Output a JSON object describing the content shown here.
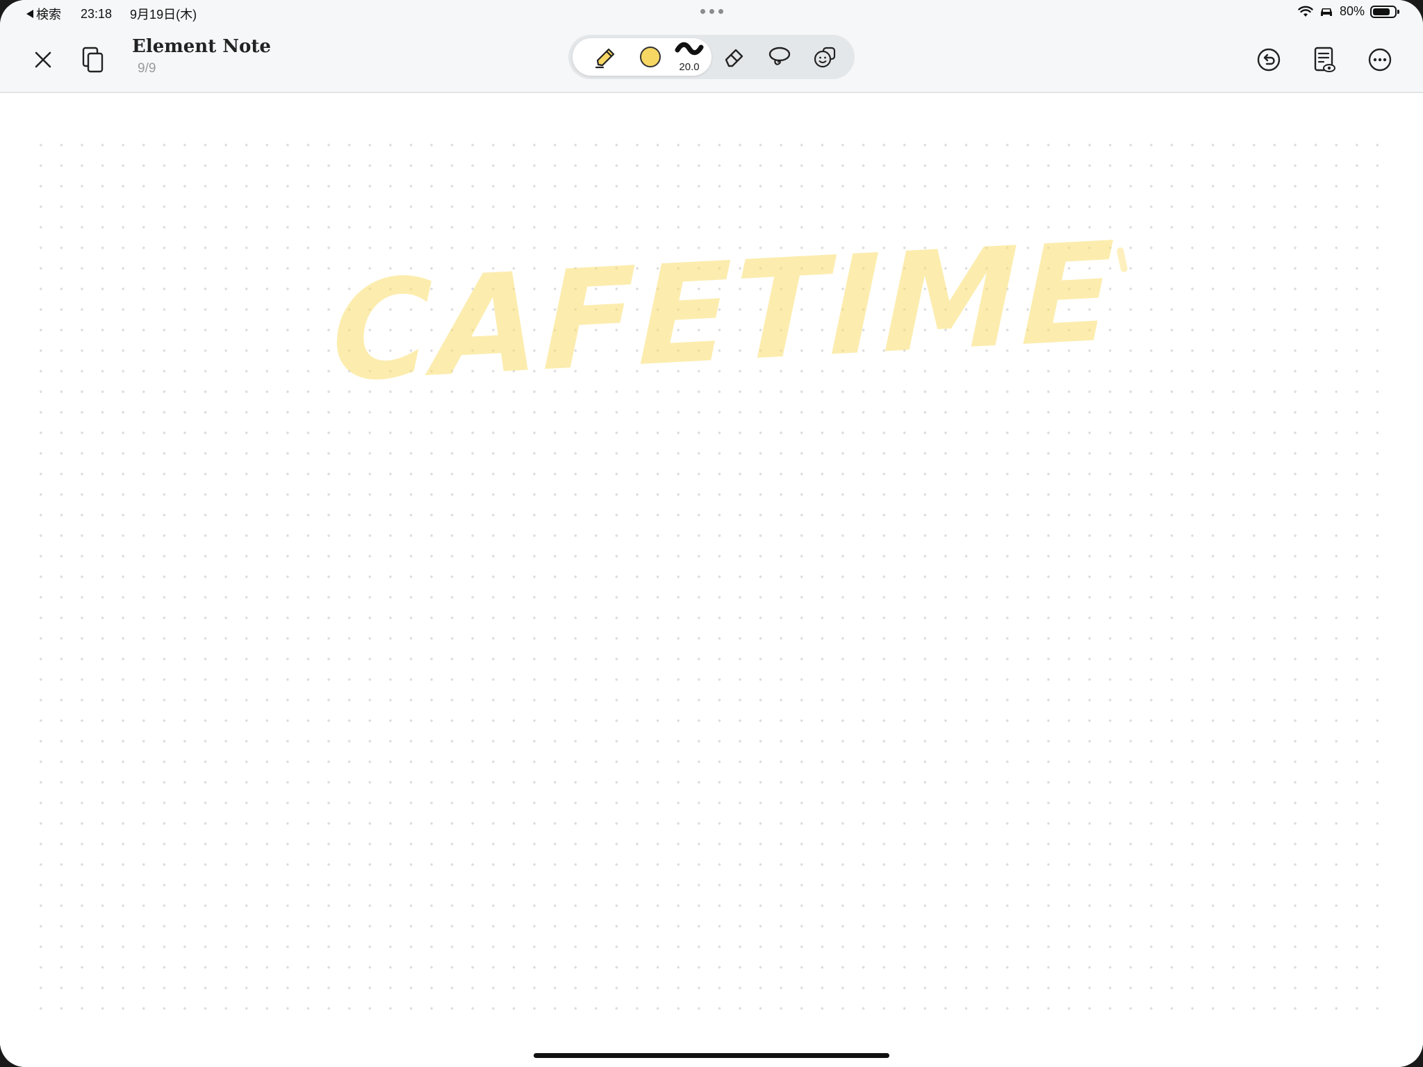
{
  "status_bar": {
    "back_label": "検索",
    "time": "23:18",
    "date": "9月19日(木)",
    "battery_percent": "80%",
    "battery_level": 0.8
  },
  "toolbar": {
    "title": "Element Note",
    "page_indicator": "9/9",
    "tools": {
      "pen": "highlighter-icon",
      "color": "#F7D763",
      "stroke_size": "20.0",
      "eraser": "eraser-icon",
      "lasso": "lasso-icon",
      "sticker": "sticker-icon"
    }
  },
  "canvas": {
    "handwritten_text": "CAFETIME",
    "ink_color": "#FADE6E",
    "background": "dot-grid"
  }
}
